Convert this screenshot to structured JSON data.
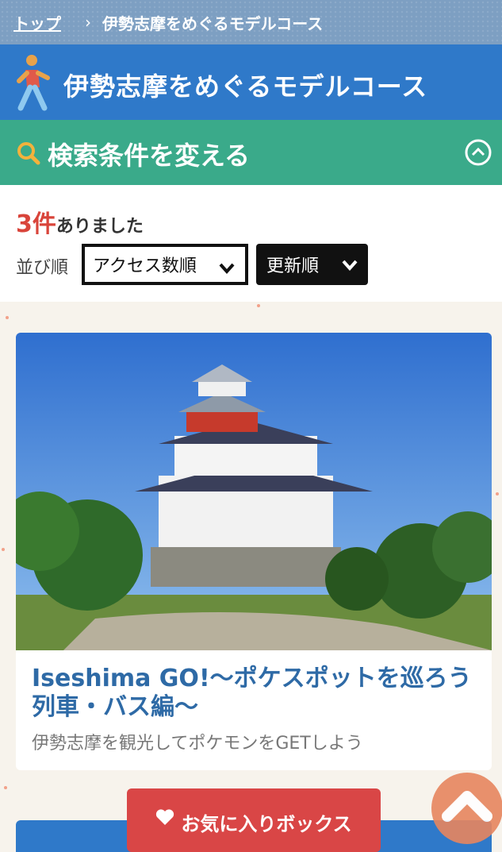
{
  "breadcrumb": {
    "top": "トップ",
    "separator": "›",
    "current": "伊勢志摩をめぐるモデルコース"
  },
  "header": {
    "title": "伊勢志摩をめぐるモデルコース"
  },
  "search": {
    "label": "検索条件を変える"
  },
  "results": {
    "count_number": "3件",
    "count_text": "ありました"
  },
  "sort": {
    "label": "並び順",
    "option1": "アクセス数順",
    "option2": "更新順"
  },
  "card": {
    "title": "Iseshima GO!〜ポケスポットを巡ろう 列車・バス編〜",
    "subtitle": "伊勢志摩を観光してポケモンをGETしよう"
  },
  "favorite": {
    "label": "お気に入りボックス"
  },
  "colors": {
    "header_blue": "#2f79c9",
    "search_green": "#3aaa8a",
    "accent_red": "#d9443a",
    "fav_red": "#d94646",
    "top_orange": "#e7865f"
  },
  "icons": {
    "walker": "walker-icon",
    "search": "search-icon",
    "chevron_up": "chevron-up-icon",
    "heart": "heart-icon",
    "scroll_top": "scroll-top-icon"
  }
}
